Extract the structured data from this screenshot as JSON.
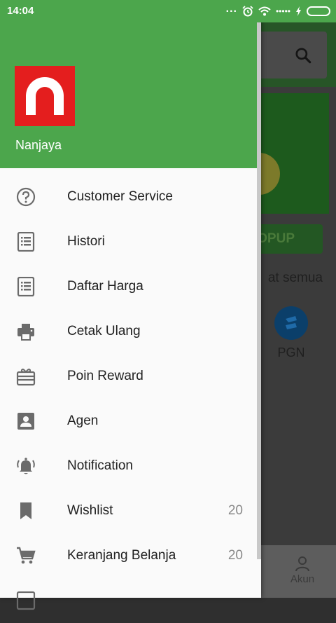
{
  "status_bar": {
    "time": "14:04",
    "dots": "...",
    "signal_dots": "•••••"
  },
  "background": {
    "topup_label": "OPUP",
    "lihat_label": "at semua",
    "pgn_label": "PGN",
    "akun_label": "Akun"
  },
  "drawer": {
    "user_name": "Nanjaya",
    "logo_icon": "nanjaya-logo",
    "items": [
      {
        "label": "Customer Service",
        "icon": "help-circle-icon",
        "count": ""
      },
      {
        "label": "Histori",
        "icon": "list-document-icon",
        "count": ""
      },
      {
        "label": "Daftar Harga",
        "icon": "price-list-icon",
        "count": ""
      },
      {
        "label": "Cetak Ulang",
        "icon": "printer-icon",
        "count": ""
      },
      {
        "label": "Poin Reward",
        "icon": "gift-card-icon",
        "count": ""
      },
      {
        "label": "Agen",
        "icon": "contact-card-icon",
        "count": ""
      },
      {
        "label": "Notification",
        "icon": "bell-ringing-icon",
        "count": ""
      },
      {
        "label": "Wishlist",
        "icon": "bookmark-icon",
        "count": "20"
      },
      {
        "label": "Keranjang Belanja",
        "icon": "shopping-cart-icon",
        "count": "20"
      }
    ]
  },
  "colors": {
    "primary_green": "#4ca64c",
    "logo_red": "#e41e1e"
  }
}
